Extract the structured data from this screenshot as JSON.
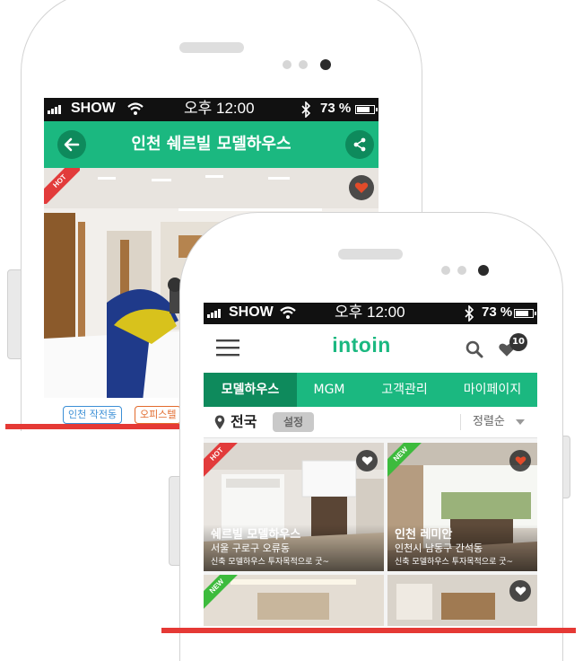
{
  "colors": {
    "brand_green": "#1bb880",
    "dark_green": "#0e8a5c",
    "hot_red": "#e23b3b",
    "new_green": "#3dbb3d",
    "heart_red": "#e24b2a",
    "accent_red": "#e53935"
  },
  "back_phone": {
    "status": {
      "carrier": "SHOW",
      "time": "오후 12:00",
      "battery": "73 %"
    },
    "header": {
      "title": "인천 쉐르빌 모델하우스",
      "back_icon": "arrow-left-icon",
      "share_icon": "share-icon"
    },
    "photo": {
      "badge": "HOT",
      "favorite_icon": "heart-icon"
    },
    "tags": [
      "인천 작전동",
      "오피스텔"
    ]
  },
  "front_phone": {
    "status": {
      "carrier": "SHOW",
      "time": "오후 12:00",
      "battery": "73 %"
    },
    "header": {
      "logo": "intoin",
      "menu_icon": "hamburger-icon",
      "search_icon": "search-icon",
      "favorites_count": "10"
    },
    "tabs": [
      "모델하우스",
      "MGM",
      "고객관리",
      "마이페이지"
    ],
    "active_tab": 0,
    "filter": {
      "location": "전국",
      "settings_label": "설정",
      "sort": "정렬순"
    },
    "cards": [
      {
        "badge": "HOT",
        "title": "쉐르빌 모델하우스",
        "address": "서울 구로구 오류동",
        "desc": "신축 모델하우스 투자목적으로 굿~",
        "favorited": false
      },
      {
        "badge": "NEW",
        "title": "인천 레미안",
        "address": "인천시 남동구 간석동",
        "desc": "신축 모델하우스 투자목적으로 굿~",
        "favorited": true
      },
      {
        "badge": "NEW",
        "title": "",
        "address": "",
        "desc": "",
        "favorited": true
      },
      {
        "badge": "",
        "title": "",
        "address": "",
        "desc": "",
        "favorited": false
      }
    ]
  }
}
